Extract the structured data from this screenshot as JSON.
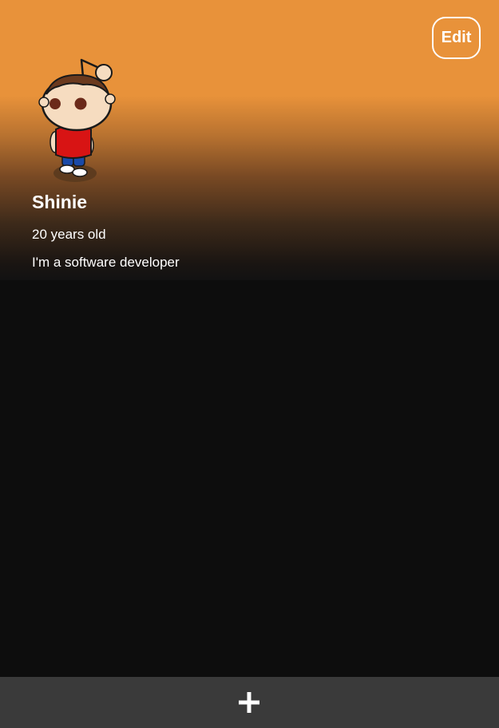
{
  "header": {
    "edit_label": "Edit",
    "gradient_top_color": "#e8923a",
    "gradient_bottom_color": "#121212"
  },
  "profile": {
    "name": "Shinie",
    "age": "20 years old",
    "bio": "I'm a software developer",
    "avatar_icon": "reddit-snoo-avatar-icon"
  },
  "footer": {
    "add_icon": "plus-icon",
    "bar_color": "#3a3a3a"
  },
  "theme": {
    "background": "#0d0d0d",
    "text": "#ffffff"
  }
}
